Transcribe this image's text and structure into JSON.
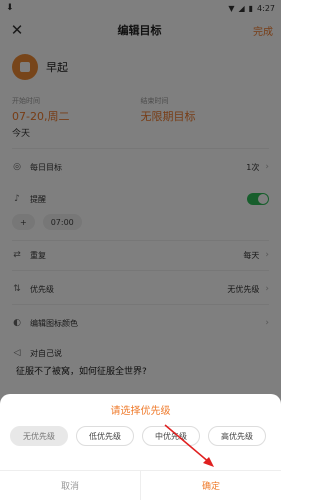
{
  "status": {
    "time": "4:27"
  },
  "appbar": {
    "title": "编辑目标",
    "done": "完成",
    "close_icon": "close-icon"
  },
  "goal": {
    "name": "早起",
    "icon_color": "#ef8b35"
  },
  "dates": {
    "start_label": "开始时间",
    "start_value": "07-20,周二",
    "start_sub": "今天",
    "end_label": "结束时间",
    "end_value": "无限期目标"
  },
  "rows": {
    "daily_label": "每日目标",
    "daily_value": "1次",
    "remind_label": "提醒",
    "remind_time": "07:00",
    "remind_add": "+",
    "repeat_label": "重复",
    "repeat_value": "每天",
    "priority_label": "优先级",
    "priority_value": "无优先级",
    "color_label": "编辑图标颜色",
    "self_label": "对自己说",
    "self_text": "征服不了被窝，如何征服全世界?"
  },
  "sheet": {
    "title": "请选择优先级",
    "options": [
      "无优先级",
      "低优先级",
      "中优先级",
      "高优先级"
    ],
    "selected": "无优先级",
    "cancel": "取消",
    "confirm": "确定"
  },
  "colors": {
    "accent": "#ef7b2c",
    "toggle_on": "#2ebd59",
    "overlay": "rgba(0,0,0,0.5)"
  }
}
